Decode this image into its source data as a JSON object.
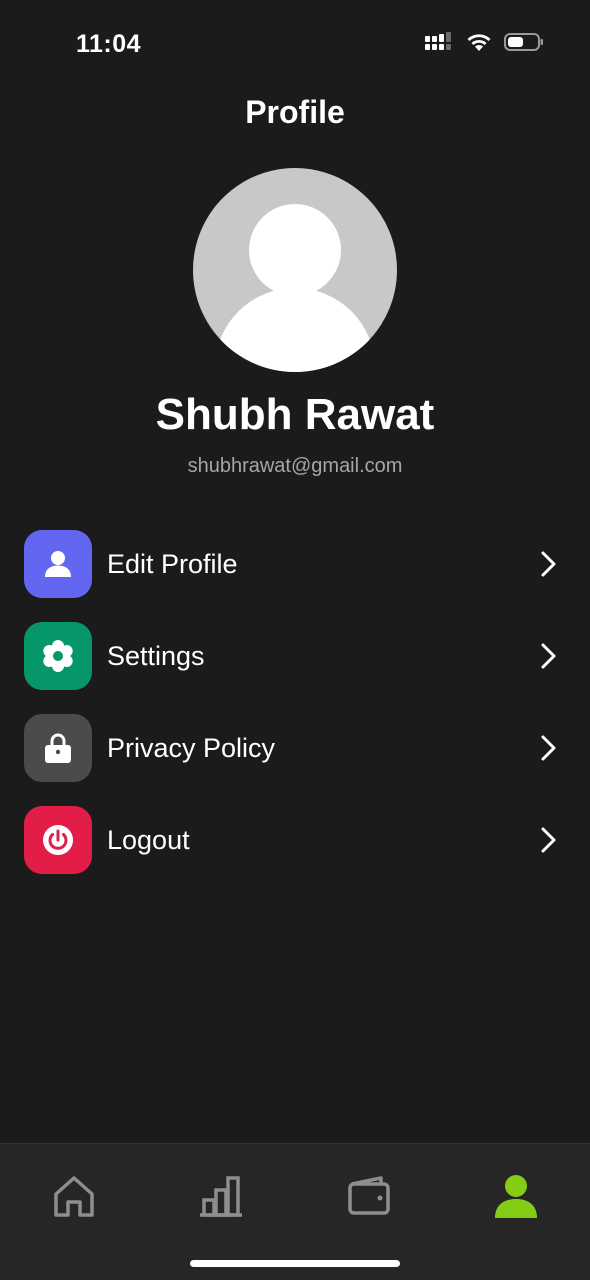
{
  "status_bar": {
    "time": "11:04",
    "icons": [
      "signal-icon",
      "wifi-icon",
      "battery-icon"
    ]
  },
  "header": {
    "title": "Profile"
  },
  "profile": {
    "name": "Shubh Rawat",
    "email": "shubhrawat@gmail.com"
  },
  "menu": {
    "items": [
      {
        "label": "Edit Profile",
        "icon": "user-icon",
        "color": "#6366f1"
      },
      {
        "label": "Settings",
        "icon": "gear-icon",
        "color": "#059669"
      },
      {
        "label": "Privacy Policy",
        "icon": "lock-icon",
        "color": "#4b4b4b"
      },
      {
        "label": "Logout",
        "icon": "power-icon",
        "color": "#e11d48"
      }
    ]
  },
  "tab_bar": {
    "tabs": [
      {
        "icon": "home-icon",
        "active": false
      },
      {
        "icon": "bar-chart-icon",
        "active": false
      },
      {
        "icon": "wallet-icon",
        "active": false
      },
      {
        "icon": "profile-icon",
        "active": true
      }
    ],
    "active_color": "#84cc16",
    "inactive_color": "#8e8e8e"
  }
}
